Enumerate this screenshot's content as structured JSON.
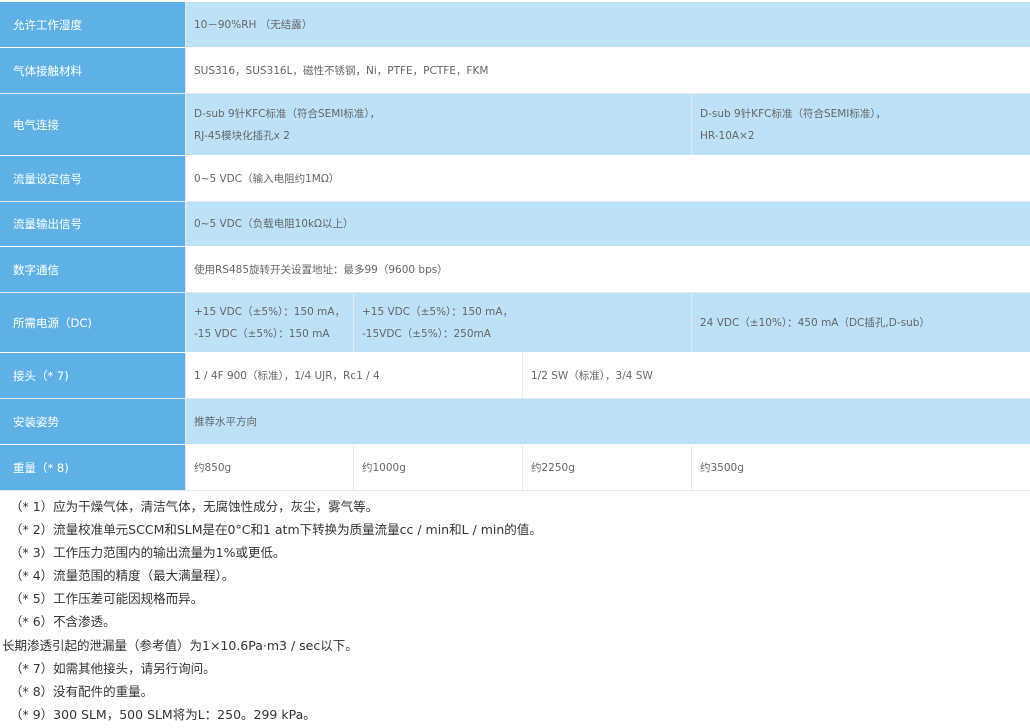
{
  "spec_rows": [
    {
      "label": "允许工作湿度",
      "cells": [
        [
          "10－90%RH （无结露）"
        ]
      ]
    },
    {
      "label": "气体接触材料",
      "cells": [
        [
          "SUS316，SUS316L，磁性不锈钢，Ni，PTFE，PCTFE，FKM"
        ]
      ]
    },
    {
      "label": "电气连接",
      "cells": [
        [
          "D-sub 9针KFC标准（符合SEMI标准），",
          "RJ-45模块化插孔x 2"
        ],
        [
          "D-sub 9针KFC标准（符合SEMI标准），",
          "HR-10A×2"
        ]
      ]
    },
    {
      "label": "流量设定信号",
      "cells": [
        [
          "0~5 VDC（输入电阻约1MΩ）"
        ]
      ]
    },
    {
      "label": "流量输出信号",
      "cells": [
        [
          "0~5 VDC（负载电阻10kΩ以上）"
        ]
      ]
    },
    {
      "label": "数字通信",
      "cells": [
        [
          "使用RS485旋转开关设置地址：最多99（9600 bps）"
        ]
      ]
    },
    {
      "label": "所需电源（DC)",
      "cells": [
        [
          "+15 VDC（±5%）：150 mA，",
          "-15 VDC（±5%）：150 mA"
        ],
        [
          "+15 VDC（±5%）：150 mA，",
          "-15VDC（±5%）：250mA"
        ],
        [
          "24 VDC（±10%）：450 mA（DC插孔,D-sub）"
        ]
      ]
    },
    {
      "label": "接头（* 7)",
      "cells": [
        [
          "1 / 4F 900（标准），1/4 UJR，Rc1 / 4"
        ],
        [
          "1/2 SW（标准），3/4 SW"
        ]
      ]
    },
    {
      "label": "安装姿势",
      "cells": [
        [
          "推荐水平方向"
        ]
      ]
    },
    {
      "label": "重量（* 8)",
      "cells": [
        [
          "约850g"
        ],
        [
          "约1000g"
        ],
        [
          "约2250g"
        ],
        [
          "约3500g"
        ]
      ]
    }
  ],
  "notes": [
    "（* 1）应为干燥气体，清洁气体，无腐蚀性成分，灰尘，雾气等。",
    "（* 2）流量校准单元SCCM和SLM是在0°C和1 atm下转换为质量流量cc / min和L / min的值。",
    "（* 3）工作压力范围内的输出流量为1%或更低。",
    "（* 4）流量范围的精度（最大满量程）。",
    "（* 5）工作压差可能因规格而异。",
    "（* 6）不含渗透。",
    "长期渗透引起的泄漏量（参考值）为1×10.6Pa·m3 / sec以下。",
    "（* 7）如需其他接头，请另行询问。",
    "（* 8）没有配件的重量。",
    "（* 9）300 SLM，500 SLM将为L：250。299 kPa。"
  ]
}
